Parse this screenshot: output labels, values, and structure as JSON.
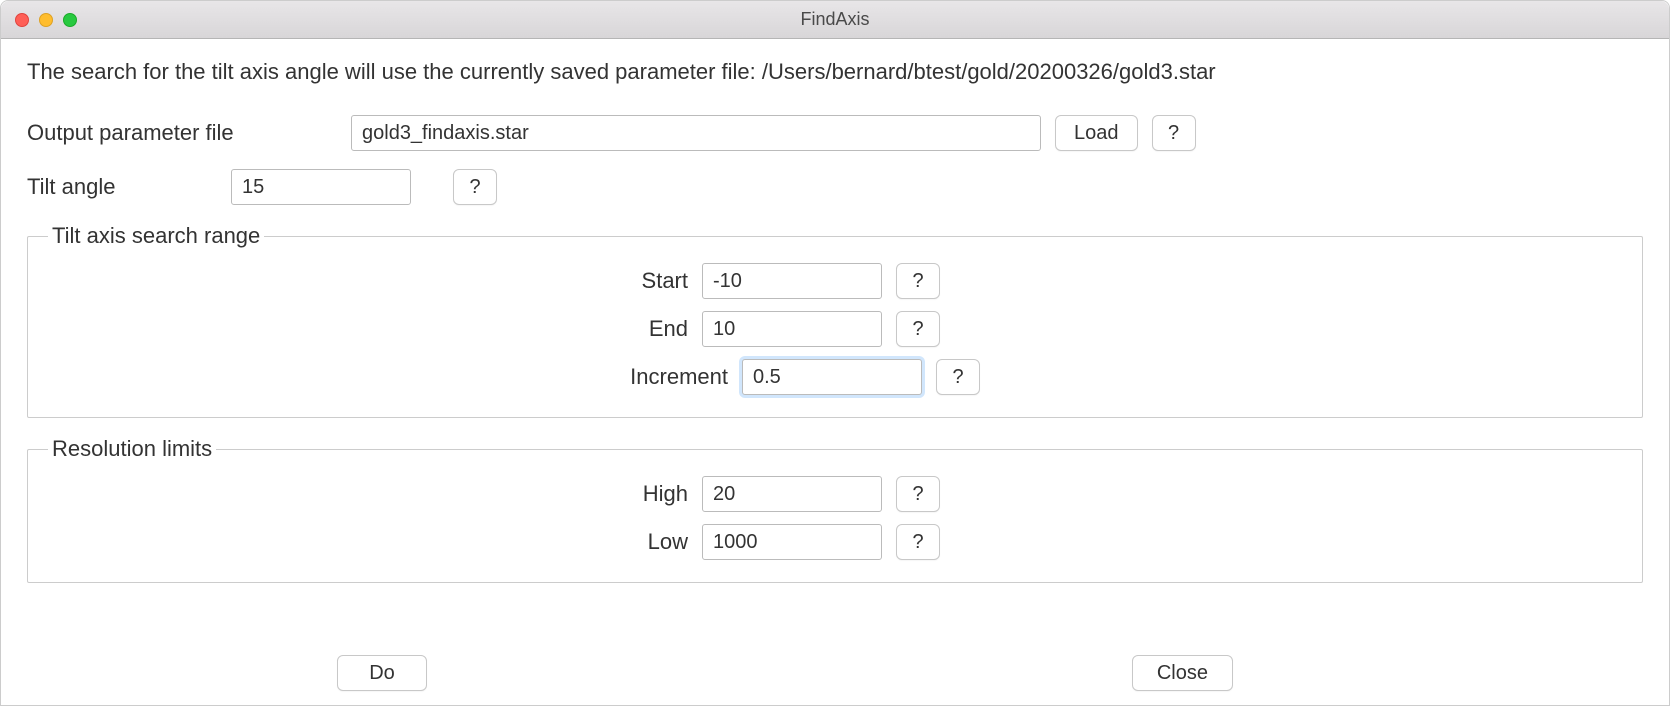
{
  "window": {
    "title": "FindAxis"
  },
  "intro": "The search for the tilt axis angle will use the currently saved parameter file: /Users/bernard/btest/gold/20200326/gold3.star",
  "labels": {
    "output_parameter_file": "Output parameter file",
    "tilt_angle": "Tilt angle",
    "tilt_axis_range_legend": "Tilt axis search range",
    "start": "Start",
    "end": "End",
    "increment": "Increment",
    "resolution_limits_legend": "Resolution limits",
    "high": "High",
    "low": "Low"
  },
  "values": {
    "output_parameter_file": "gold3_findaxis.star",
    "tilt_angle": "15",
    "start": "-10",
    "end": "10",
    "increment": "0.5",
    "high": "20",
    "low": "1000"
  },
  "buttons": {
    "load": "Load",
    "help": "?",
    "do": "Do",
    "close": "Close"
  }
}
